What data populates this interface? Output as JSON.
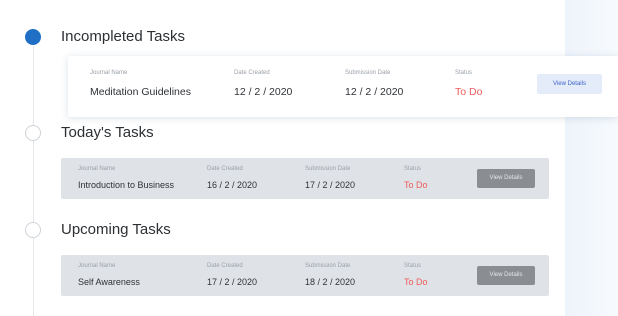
{
  "sections": [
    {
      "title": "Incompleted Tasks",
      "card": {
        "journal_label": "Journal Name",
        "journal_value": "Meditation Guidelines",
        "created_label": "Date Created",
        "created_value": "12 / 2 / 2020",
        "submission_label": "Submission Date",
        "submission_value": "12 / 2 / 2020",
        "status_label": "Status",
        "status_value": "To Do",
        "button_label": "View Details"
      }
    },
    {
      "title": "Today's Tasks",
      "card": {
        "journal_label": "Journal Name",
        "journal_value": "Introduction to Business",
        "created_label": "Date Created",
        "created_value": "16 / 2 / 2020",
        "submission_label": "Submission Date",
        "submission_value": "17 / 2 / 2020",
        "status_label": "Status",
        "status_value": "To Do",
        "button_label": "View Details"
      }
    },
    {
      "title": "Upcoming Tasks",
      "card": {
        "journal_label": "Journal Name",
        "journal_value": "Self Awareness",
        "created_label": "Date Created",
        "created_value": "17 / 2 / 2020",
        "submission_label": "Submission Date",
        "submission_value": "18 / 2 / 2020",
        "status_label": "Status",
        "status_value": "To Do",
        "button_label": "View Details"
      }
    }
  ],
  "colors": {
    "active_dot": "#1f6fc4",
    "status_todo": "#ef5b5b",
    "primary_button_bg": "#e4ebf9",
    "primary_button_text": "#3e63c9",
    "grey_button_bg": "#8a8d91"
  }
}
